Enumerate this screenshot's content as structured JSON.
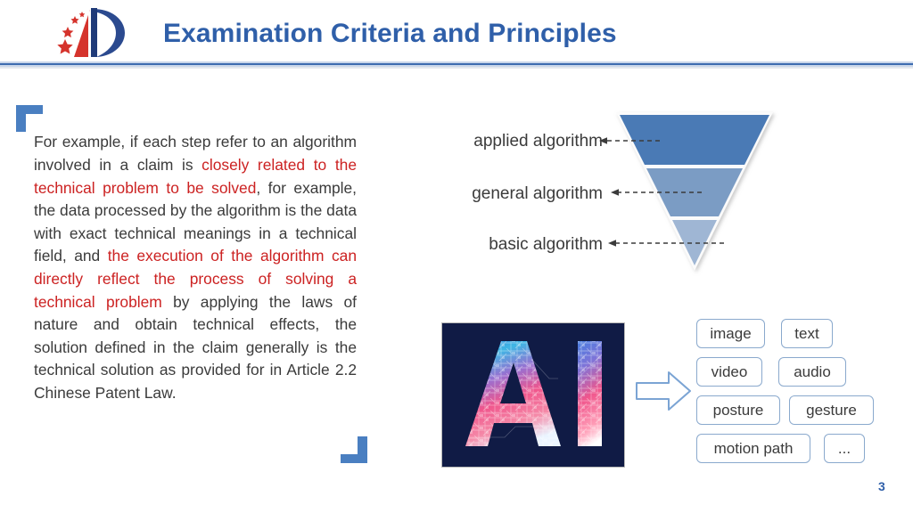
{
  "header": {
    "title": "Examination Criteria and Principles",
    "logo_name": "cnipa-logo",
    "title_color": "#2f5fa9",
    "rule_color": "#3d6cb0"
  },
  "body": {
    "segments": [
      {
        "text": "For example, if each step refer to an algorithm involved in a claim is ",
        "highlight": false
      },
      {
        "text": "closely related to the technical problem to be solved",
        "highlight": true
      },
      {
        "text": ", for example, the data processed by the algorithm is the data with exact technical meanings in a technical field, and ",
        "highlight": false
      },
      {
        "text": "the execution of the algorithm can directly reflect the process of solving a technical problem",
        "highlight": true
      },
      {
        "text": " by applying the laws of nature and obtain technical effects, the solution defined in the claim generally is the technical solution as provided for in Article 2.2 Chinese Patent Law.",
        "highlight": false
      }
    ],
    "highlight_color": "#cc2222",
    "text_color": "#3b3b3b"
  },
  "funnel": {
    "labels": [
      "applied algorithm",
      "general algorithm",
      "basic algorithm"
    ],
    "segment_colors": [
      "#4a7ab5",
      "#7b9cc4",
      "#9fb6d4"
    ],
    "arrow_style": "dashed-left-arrow"
  },
  "ai_picture": {
    "caption": "AI",
    "background_color": "#101b45",
    "accent_colors": [
      "#2a6fd6",
      "#39c6e8",
      "#f0568c",
      "#ffffff"
    ]
  },
  "flow": {
    "arrow_name": "right-block-arrow",
    "arrow_color": "#7ba4d4"
  },
  "chips": {
    "items": [
      {
        "label": "image"
      },
      {
        "label": "text"
      },
      {
        "label": "video"
      },
      {
        "label": "audio"
      },
      {
        "label": "posture"
      },
      {
        "label": "gesture"
      },
      {
        "label": "motion path"
      },
      {
        "label": "..."
      }
    ],
    "border_color": "#8aa9cd"
  },
  "footer": {
    "page_number": "3"
  }
}
